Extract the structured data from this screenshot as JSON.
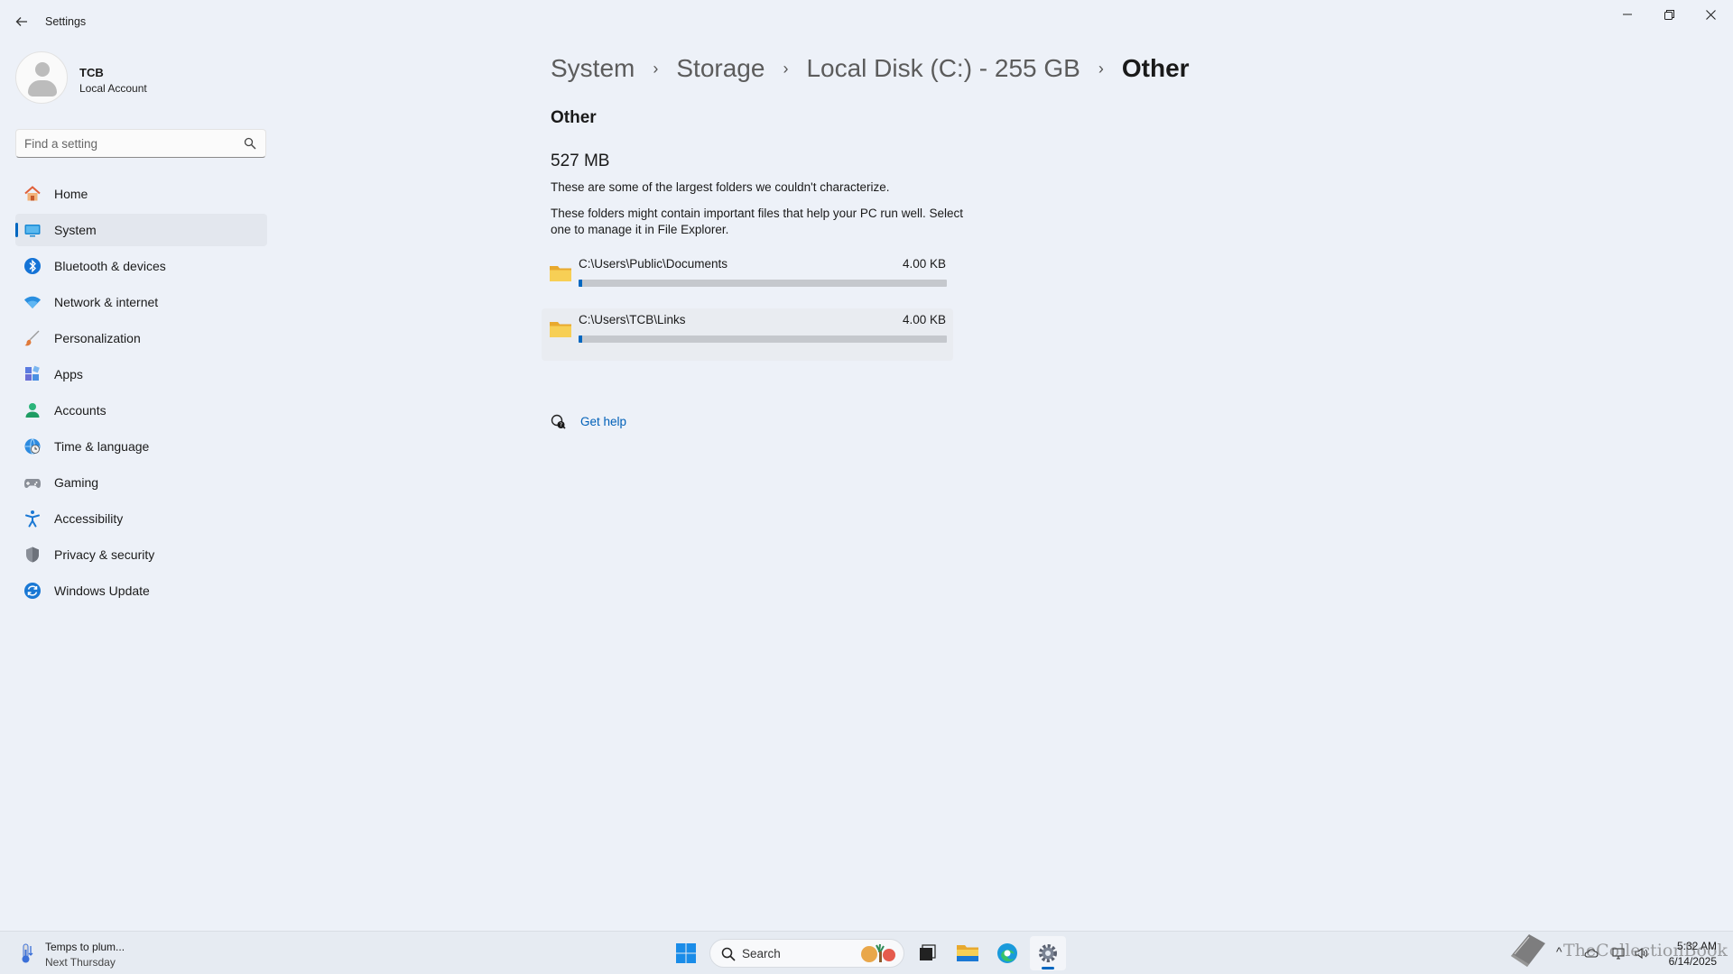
{
  "window": {
    "title": "Settings",
    "controls": {
      "minimize": "—",
      "maximize": "❐",
      "close": "✕"
    }
  },
  "profile": {
    "name": "TCB",
    "account_type": "Local Account"
  },
  "search": {
    "placeholder": "Find a setting"
  },
  "nav": {
    "items": [
      {
        "label": "Home",
        "icon": "home-icon"
      },
      {
        "label": "System",
        "icon": "system-icon",
        "active": true
      },
      {
        "label": "Bluetooth & devices",
        "icon": "bluetooth-icon"
      },
      {
        "label": "Network & internet",
        "icon": "wifi-icon"
      },
      {
        "label": "Personalization",
        "icon": "brush-icon"
      },
      {
        "label": "Apps",
        "icon": "apps-icon"
      },
      {
        "label": "Accounts",
        "icon": "accounts-icon"
      },
      {
        "label": "Time & language",
        "icon": "globe-clock-icon"
      },
      {
        "label": "Gaming",
        "icon": "gamepad-icon"
      },
      {
        "label": "Accessibility",
        "icon": "accessibility-icon"
      },
      {
        "label": "Privacy & security",
        "icon": "shield-icon"
      },
      {
        "label": "Windows Update",
        "icon": "update-icon"
      }
    ]
  },
  "breadcrumb": {
    "items": [
      "System",
      "Storage",
      "Local Disk (C:) - 255 GB",
      "Other"
    ],
    "separator": "›"
  },
  "content": {
    "section_title": "Other",
    "total_size": "527 MB",
    "description1": "These are some of the largest folders we couldn't characterize.",
    "description2": "These folders might contain important files that help your PC run well. Select one to manage it in File Explorer.",
    "folders": [
      {
        "path": "C:\\Users\\Public\\Documents",
        "size": "4.00 KB",
        "usage_fraction": 0.01
      },
      {
        "path": "C:\\Users\\TCB\\Links",
        "size": "4.00 KB",
        "usage_fraction": 0.01
      }
    ],
    "help_link": "Get help"
  },
  "taskbar": {
    "weather": {
      "title": "Temps to plum...",
      "subtitle": "Next Thursday"
    },
    "search_label": "Search",
    "apps": [
      "start-icon",
      "task-view-icon",
      "file-explorer-icon",
      "edge-icon",
      "settings-icon"
    ],
    "clock": {
      "time": "5:32 AM",
      "date": "6/14/2025"
    },
    "tray_chevron": "^"
  },
  "watermark": {
    "text": "TheCollectionBook"
  },
  "colors": {
    "accent": "#0067c0",
    "folder": "#f4c542",
    "link": "#0060b8"
  }
}
